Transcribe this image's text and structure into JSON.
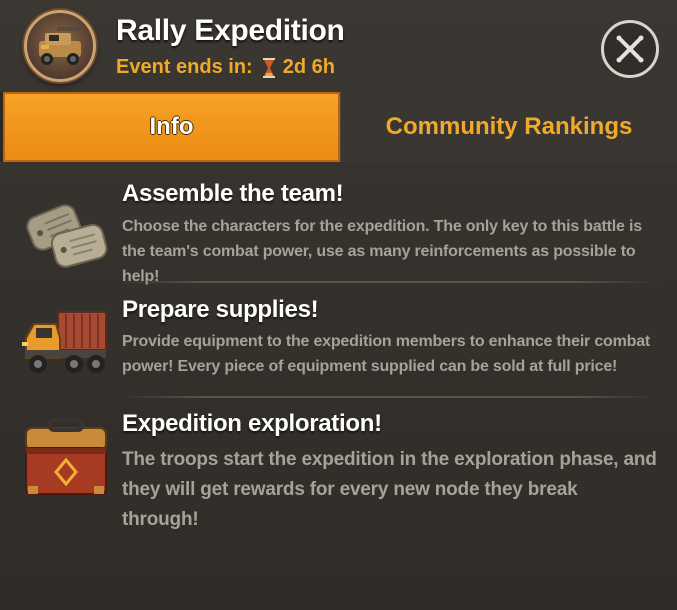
{
  "header": {
    "title": "Rally Expedition",
    "event_ends_label": "Event ends in:",
    "event_ends_value": "2d 6h",
    "avatar_icon": "armored-vehicle-icon",
    "close_icon": "close-icon"
  },
  "tabs": [
    {
      "label": "Info",
      "active": true
    },
    {
      "label": "Community Rankings",
      "active": false
    }
  ],
  "items": [
    {
      "icon": "dog-tags-icon",
      "title": "Assemble the team!",
      "description": "Choose the characters for the expedition. The only key to this battle is the team's combat power, use as many reinforcements as possible to help!"
    },
    {
      "icon": "supply-truck-icon",
      "title": "Prepare supplies!",
      "description": "Provide equipment to the expedition members to enhance their combat power! Every piece of equipment supplied can be sold at full price!"
    },
    {
      "icon": "treasure-chest-icon",
      "title": "Expedition exploration!",
      "description": "The troops start the expedition in the exploration phase, and they will get rewards for every new node they break through!"
    }
  ],
  "colors": {
    "accent": "#f0a92a",
    "tab_active": "#f29a1d",
    "background": "#35312d",
    "description_text": "#a8a19a"
  }
}
